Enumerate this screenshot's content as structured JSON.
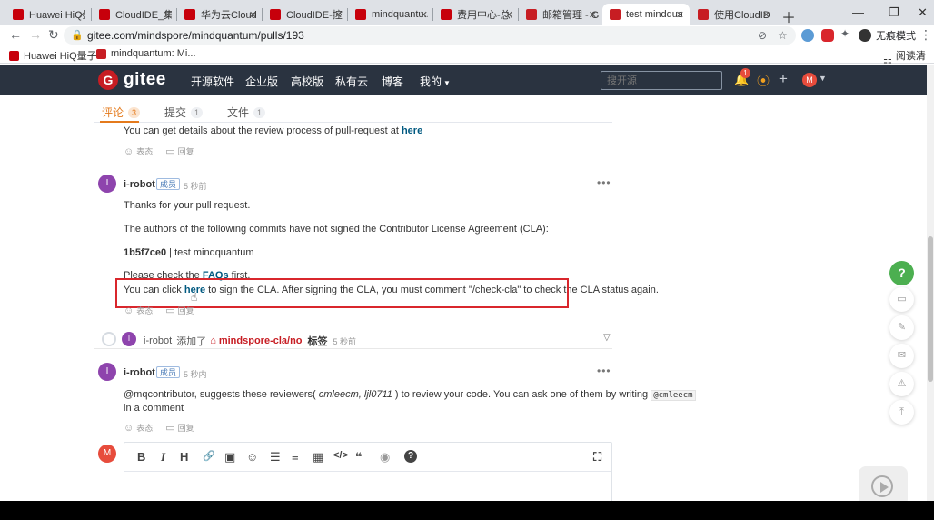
{
  "browser": {
    "tabs": [
      {
        "title": "Huawei HiQ量...",
        "icon_color": "#c7000b"
      },
      {
        "title": "CloudIDE_集...",
        "icon_color": "#c7000b"
      },
      {
        "title": "华为云CloudI...",
        "icon_color": "#c7000b"
      },
      {
        "title": "CloudIDE-控...",
        "icon_color": "#c7000b"
      },
      {
        "title": "mindquantu...",
        "icon_color": "#c7000b"
      },
      {
        "title": "费用中心-总...",
        "icon_color": "#c7000b"
      },
      {
        "title": "邮箱管理 - Gi...",
        "icon_color": "#c71d23"
      },
      {
        "title": "test mindqua...",
        "icon_color": "#c71d23",
        "active": true
      },
      {
        "title": "使用CloudIDE...",
        "icon_color": "#c71d23"
      }
    ],
    "url": "gitee.com/mindspore/mindquantum/pulls/193",
    "incognito_label": "无痕模式",
    "bookmarks": [
      {
        "label": "Huawei HiQ量子...",
        "icon_color": "#c7000b"
      },
      {
        "label": "mindquantum: Mi...",
        "icon_color": "#c71d23"
      }
    ],
    "reading_list": "阅读清单"
  },
  "gitee": {
    "logo_text": "gitee",
    "logo_mark": "G",
    "nav": [
      "开源软件",
      "企业版",
      "高校版",
      "私有云",
      "博客",
      "我的"
    ],
    "search_placeholder": "搜开源",
    "notification_count": "1",
    "user_initial": "M"
  },
  "subtabs": [
    {
      "label": "评论",
      "count": "3",
      "active": true
    },
    {
      "label": "提交",
      "count": "1"
    },
    {
      "label": "文件",
      "count": "1"
    }
  ],
  "comments": {
    "first_tail": {
      "text": "You can get details about the review process of pull-request at ",
      "link": "here"
    },
    "actions": {
      "react": "表态",
      "reply": "回复"
    },
    "cla": {
      "author": "i-robot",
      "initial": "I",
      "role": "成员",
      "time": "5 秒前",
      "line1": "Thanks for your pull request.",
      "line2": "The authors of the following commits have not signed the Contributor License Agreement (CLA):",
      "commit": "1b5f7ce0",
      "commit_rest": " | test mindquantum",
      "line4_pre": "Please check the ",
      "line4_link": "FAQs",
      "line4_post": " first.",
      "line5_pre": "You can click ",
      "line5_link": "here",
      "line5_post": " to sign the CLA. After signing the CLA, you must comment \"/check-cla\" to check the CLA status again."
    },
    "event": {
      "initial": "I",
      "actor": "i-robot",
      "action": "添加了",
      "label": "mindspore-cla/no",
      "label_word": "标签",
      "time": "5 秒前"
    },
    "reviewers": {
      "author": "i-robot",
      "initial": "I",
      "role": "成员",
      "time": "5 秒内",
      "pre": "@mqcontributor, suggests these reviewers( ",
      "names": "cmleecm, ljl0711",
      "mid": " ) to review your code. You can ask one of them by writing ",
      "code": "@cmleecm",
      "line2": "in a comment"
    }
  },
  "editor": {
    "user_initial": "M",
    "tools": [
      "B",
      "I",
      "H",
      "🔗",
      "▣",
      "☺",
      "☰",
      "≡",
      "▦",
      "</>",
      "❝",
      "◉",
      "?",
      "⛶"
    ]
  },
  "floating": {
    "help": "?"
  },
  "colors": {
    "gitee_red": "#c71d23",
    "nav_bg": "#2a3340",
    "active_tab_orange": "#e47a1c",
    "highlight_red": "#d9262c",
    "link_blue": "#005980"
  }
}
